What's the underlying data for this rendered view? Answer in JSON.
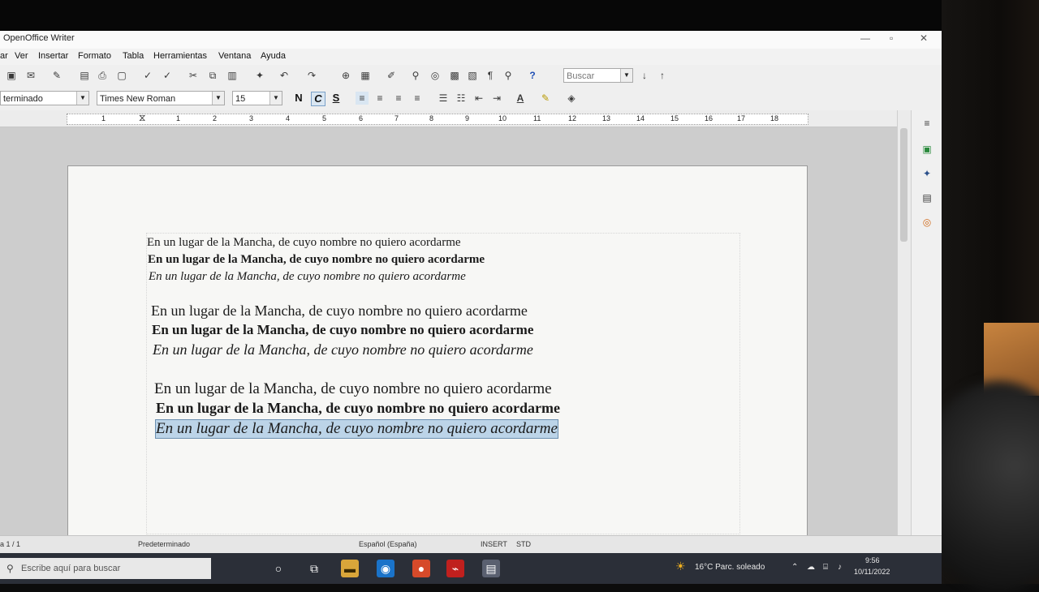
{
  "window": {
    "title": "OpenOffice Writer",
    "controls": {
      "minimize": "—",
      "maximize": "▫",
      "close": "✕"
    }
  },
  "menu": [
    {
      "label": "ar"
    },
    {
      "label": "Ver"
    },
    {
      "label": "Insertar"
    },
    {
      "label": "Formato"
    },
    {
      "label": "Tabla"
    },
    {
      "label": "Herramientas"
    },
    {
      "label": "Ventana"
    },
    {
      "label": "Ayuda"
    }
  ],
  "toolbar": {
    "search_value": "Buscar",
    "paragraph_style": "terminado",
    "font_name": "Times New Roman",
    "font_size": "15",
    "bold_label": "N",
    "italic_label": "C",
    "underline_label": "S"
  },
  "ruler": {
    "numbers": [
      "1",
      "1",
      "2",
      "3",
      "4",
      "5",
      "6",
      "7",
      "8",
      "9",
      "10",
      "11",
      "12",
      "13",
      "14",
      "15",
      "16",
      "17",
      "18"
    ]
  },
  "document": {
    "lines": [
      {
        "text": "En un lugar de la Mancha, de cuyo nombre no quiero acordarme",
        "style": "normal"
      },
      {
        "text": "En un lugar de la Mancha, de cuyo nombre no quiero acordarme",
        "style": "bold"
      },
      {
        "text": "En un lugar de la Mancha, de cuyo nombre no quiero acordarme",
        "style": "italic"
      },
      {
        "text": "En un lugar de la Mancha, de cuyo nombre no quiero acordarme",
        "style": "normal"
      },
      {
        "text": "En un lugar de la Mancha, de cuyo nombre no quiero acordarme",
        "style": "bold"
      },
      {
        "text": "En un lugar de la Mancha, de cuyo nombre no quiero acordarme",
        "style": "italic"
      },
      {
        "text": "En un lugar de la Mancha, de cuyo nombre no quiero acordarme",
        "style": "normal"
      },
      {
        "text": "En un lugar de la Mancha, de cuyo nombre no quiero acordarme",
        "style": "bold"
      },
      {
        "text": "En un lugar de la Mancha, de cuyo nombre no quiero acordarme",
        "style": "italic-selected"
      }
    ]
  },
  "status": {
    "page": "a 1 / 1",
    "style": "Predeterminado",
    "language": "Español (España)",
    "mode": "INSERT",
    "selection_mode": "STD"
  },
  "taskbar": {
    "search_placeholder": "Escribe aquí para buscar",
    "weather": "16°C  Parc. soleado",
    "time": "9:56",
    "date": "10/11/2022"
  },
  "colors": {
    "selection": "#bcd4e8",
    "taskbar": "#2b2f38",
    "help_icon": "#1f4fb5",
    "edge_icon": "#1a73c9",
    "chrome_icon": "#d64a2a",
    "acrobat_icon": "#c0201e"
  }
}
